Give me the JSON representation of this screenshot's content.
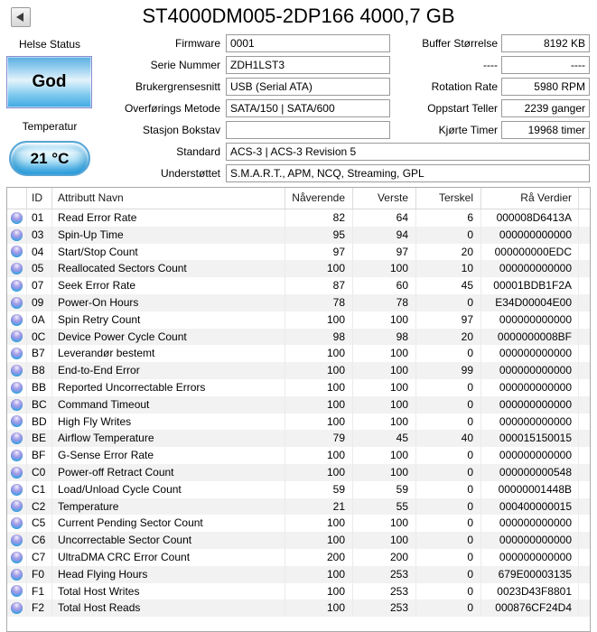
{
  "window": {
    "title": "ST4000DM005-2DP166 4000,7 GB"
  },
  "health": {
    "label": "Helse Status",
    "status": "God"
  },
  "temperature": {
    "label": "Temperatur",
    "value": "21 °C"
  },
  "info_left": [
    {
      "label": "Firmware",
      "value": "0001"
    },
    {
      "label": "Serie Nummer",
      "value": "ZDH1LST3"
    },
    {
      "label": "Brukergrensesnitt",
      "value": "USB (Serial ATA)"
    },
    {
      "label": "Overførings Metode",
      "value": "SATA/150 | SATA/600"
    },
    {
      "label": "Stasjon Bokstav",
      "value": ""
    }
  ],
  "info_right": [
    {
      "label": "Buffer Størrelse",
      "value": "8192 KB"
    },
    {
      "label": "----",
      "value": "----"
    },
    {
      "label": "Rotation Rate",
      "value": "5980 RPM"
    },
    {
      "label": "Oppstart Teller",
      "value": "2239 ganger"
    },
    {
      "label": "Kjørte Timer",
      "value": "19968 timer"
    }
  ],
  "info_wide": [
    {
      "label": "Standard",
      "value": "ACS-3 | ACS-3 Revision 5"
    },
    {
      "label": "Understøttet",
      "value": "S.M.A.R.T., APM, NCQ, Streaming, GPL"
    }
  ],
  "smart_table": {
    "headers": {
      "status": "",
      "id": "ID",
      "name": "Attributt Navn",
      "current": "Nåverende",
      "worst": "Verste",
      "threshold": "Terskel",
      "raw": "Rå Verdier"
    },
    "rows": [
      {
        "id": "01",
        "name": "Read Error Rate",
        "current": "82",
        "worst": "64",
        "threshold": "6",
        "raw": "000008D6413A"
      },
      {
        "id": "03",
        "name": "Spin-Up Time",
        "current": "95",
        "worst": "94",
        "threshold": "0",
        "raw": "000000000000"
      },
      {
        "id": "04",
        "name": "Start/Stop Count",
        "current": "97",
        "worst": "97",
        "threshold": "20",
        "raw": "000000000EDC"
      },
      {
        "id": "05",
        "name": "Reallocated Sectors Count",
        "current": "100",
        "worst": "100",
        "threshold": "10",
        "raw": "000000000000"
      },
      {
        "id": "07",
        "name": "Seek Error Rate",
        "current": "87",
        "worst": "60",
        "threshold": "45",
        "raw": "00001BDB1F2A"
      },
      {
        "id": "09",
        "name": "Power-On Hours",
        "current": "78",
        "worst": "78",
        "threshold": "0",
        "raw": "E34D00004E00"
      },
      {
        "id": "0A",
        "name": "Spin Retry Count",
        "current": "100",
        "worst": "100",
        "threshold": "97",
        "raw": "000000000000"
      },
      {
        "id": "0C",
        "name": "Device Power Cycle Count",
        "current": "98",
        "worst": "98",
        "threshold": "20",
        "raw": "0000000008BF"
      },
      {
        "id": "B7",
        "name": "Leverandør bestemt",
        "current": "100",
        "worst": "100",
        "threshold": "0",
        "raw": "000000000000"
      },
      {
        "id": "B8",
        "name": "End-to-End Error",
        "current": "100",
        "worst": "100",
        "threshold": "99",
        "raw": "000000000000"
      },
      {
        "id": "BB",
        "name": "Reported Uncorrectable Errors",
        "current": "100",
        "worst": "100",
        "threshold": "0",
        "raw": "000000000000"
      },
      {
        "id": "BC",
        "name": "Command Timeout",
        "current": "100",
        "worst": "100",
        "threshold": "0",
        "raw": "000000000000"
      },
      {
        "id": "BD",
        "name": "High Fly Writes",
        "current": "100",
        "worst": "100",
        "threshold": "0",
        "raw": "000000000000"
      },
      {
        "id": "BE",
        "name": "Airflow Temperature",
        "current": "79",
        "worst": "45",
        "threshold": "40",
        "raw": "000015150015"
      },
      {
        "id": "BF",
        "name": "G-Sense Error Rate",
        "current": "100",
        "worst": "100",
        "threshold": "0",
        "raw": "000000000000"
      },
      {
        "id": "C0",
        "name": "Power-off Retract Count",
        "current": "100",
        "worst": "100",
        "threshold": "0",
        "raw": "000000000548"
      },
      {
        "id": "C1",
        "name": "Load/Unload Cycle Count",
        "current": "59",
        "worst": "59",
        "threshold": "0",
        "raw": "00000001448B"
      },
      {
        "id": "C2",
        "name": "Temperature",
        "current": "21",
        "worst": "55",
        "threshold": "0",
        "raw": "000400000015"
      },
      {
        "id": "C5",
        "name": "Current Pending Sector Count",
        "current": "100",
        "worst": "100",
        "threshold": "0",
        "raw": "000000000000"
      },
      {
        "id": "C6",
        "name": "Uncorrectable Sector Count",
        "current": "100",
        "worst": "100",
        "threshold": "0",
        "raw": "000000000000"
      },
      {
        "id": "C7",
        "name": "UltraDMA CRC Error Count",
        "current": "200",
        "worst": "200",
        "threshold": "0",
        "raw": "000000000000"
      },
      {
        "id": "F0",
        "name": "Head Flying Hours",
        "current": "100",
        "worst": "253",
        "threshold": "0",
        "raw": "679E00003135"
      },
      {
        "id": "F1",
        "name": "Total Host Writes",
        "current": "100",
        "worst": "253",
        "threshold": "0",
        "raw": "0023D43F8801"
      },
      {
        "id": "F2",
        "name": "Total Host Reads",
        "current": "100",
        "worst": "253",
        "threshold": "0",
        "raw": "000876CF24D4"
      }
    ]
  },
  "colors": {
    "health_blue": "#3fa9e2",
    "health_border": "#8a8ad0",
    "temp_blue": "#45b2ea",
    "status_orb_blue": "#2fa8e6",
    "status_orb_violet": "#aaa2ea"
  }
}
